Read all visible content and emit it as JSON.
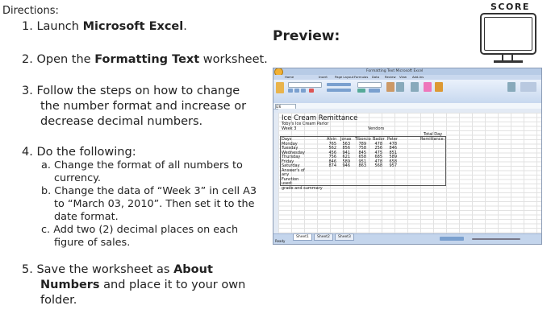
{
  "header": {
    "directions_label": "Directions:",
    "score_label": "SCORE",
    "preview_label": "Preview:"
  },
  "steps": [
    {
      "num": "1.",
      "pre": "Launch ",
      "bold": "Microsoft Excel",
      "post": "."
    },
    {
      "num": "2.",
      "pre": "Open the ",
      "bold": "Formatting Text",
      "post": " worksheet."
    },
    {
      "num": "3.",
      "line1": "Follow the steps on how to change",
      "line2": "the number format and increase or",
      "line3": "decrease decimal numbers."
    },
    {
      "num": "4.",
      "text": "Do the following:"
    },
    {
      "num": "5.",
      "pre": "Save the worksheet as ",
      "bold1": "About",
      "bold2": "Numbers",
      "post2": " and place it to your own",
      "line3": "folder."
    }
  ],
  "substeps": [
    {
      "letter": "a.",
      "line1": "Change the format of all numbers to",
      "line2": "currency."
    },
    {
      "letter": "b.",
      "line1": "Change the data of “Week 3” in cell A3",
      "line2": "to “March 03, 2010”. Then set it to the",
      "line3": "date format."
    },
    {
      "letter": "c.",
      "line1": "Add two (2) decimal places on each",
      "line2": "figure of sales."
    }
  ],
  "spreadsheet": {
    "title_bar": "Formatting Text Microsoft Excel",
    "tabs": [
      "Home",
      "Insert",
      "Page Layout",
      "Formulas",
      "Data",
      "Review",
      "View",
      "Add-Ins"
    ],
    "name_box": "I26",
    "sheet_title": "Ice Cream Remittance",
    "subtitle": "Toby's Ice Cream Parlor",
    "week": "Week 3",
    "vendors_label": "Vendors",
    "total_label_1": "Total Day",
    "total_label_2": "Remittance:",
    "headers": [
      "Days",
      "Alvin",
      "Jonas",
      "Tiborcio",
      "Bador",
      "Peter"
    ],
    "rows": [
      {
        "day": "Monday",
        "values": [
          "765",
          "563",
          "789",
          "478",
          "478"
        ]
      },
      {
        "day": "Tuesday",
        "values": [
          "562",
          "856",
          "758",
          "256",
          "846"
        ]
      },
      {
        "day": "Wednesday",
        "values": [
          "456",
          "941",
          "845",
          "475",
          "851"
        ]
      },
      {
        "day": "Thursday",
        "values": [
          "756",
          "621",
          "658",
          "685",
          "589"
        ]
      },
      {
        "day": "Friday",
        "values": [
          "846",
          "589",
          "951",
          "478",
          "658"
        ]
      },
      {
        "day": "Saturday",
        "values": [
          "874",
          "946",
          "863",
          "568",
          "957"
        ]
      }
    ],
    "answer_lines": [
      "Answer's of",
      "any",
      "Function",
      "used:"
    ],
    "grade_line": "grade and summary",
    "sheet_tabs": [
      "Sheet1",
      "Sheet2",
      "Sheet3"
    ],
    "status_text": "Ready"
  }
}
